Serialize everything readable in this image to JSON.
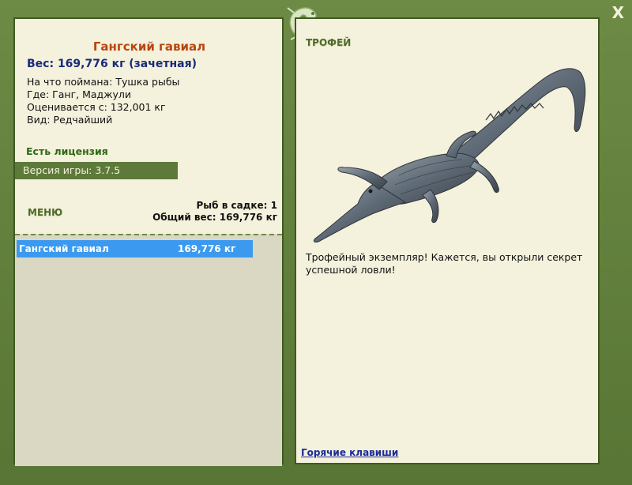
{
  "window": {
    "close_label": "X"
  },
  "fish": {
    "name": "Гангский гавиал",
    "weight": "Вес: 169,776 кг (зачетная)",
    "caught_on": "На что поймана: Тушка рыбы",
    "where": "Где: Ганг, Маджули",
    "valued_from": "Оценивается с: 132,001 кг",
    "kind": "Вид: Редчайший"
  },
  "license": "Есть лицензия",
  "version": "Версия игры: 3.7.5",
  "menu_label": "МЕНЮ",
  "stats": {
    "fish_count": "Рыб в садке: 1",
    "total_weight": "Общий вес: 169,776 кг"
  },
  "catch_list": [
    {
      "name": "Гангский гавиал",
      "weight": "169,776 кг"
    }
  ],
  "trophy": {
    "label": "ТРОФЕЙ",
    "description": "Трофейный экземпляр! Кажется, вы открыли секрет успешной ловли!"
  },
  "hotkeys_label": "Горячие клавиши",
  "icons": {
    "logo": "lizard-logo-icon",
    "close": "close-icon",
    "trophy_image": "gharial-image"
  },
  "colors": {
    "frame": "#5e7a3a",
    "panel": "#f4f1dc",
    "title": "#b8460f",
    "weight": "#1a2a7a",
    "selection": "#3b9af0"
  }
}
